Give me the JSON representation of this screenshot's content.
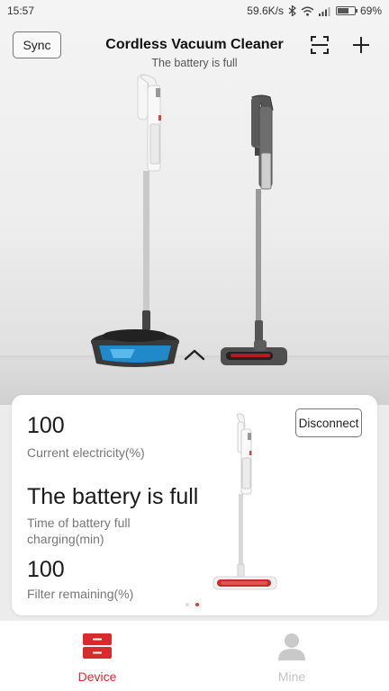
{
  "status_bar": {
    "time": "15:57",
    "network_speed": "59.6K/s",
    "battery_percent": "69%",
    "battery_level": 0.69,
    "icons": [
      "bluetooth-icon",
      "wifi-icon",
      "signal-icon",
      "battery-icon"
    ]
  },
  "header": {
    "sync_label": "Sync",
    "title": "Cordless Vacuum Cleaner",
    "subtitle": "The battery is full",
    "icons": [
      "scan-icon",
      "plus-icon"
    ]
  },
  "card": {
    "electricity_value": "100",
    "electricity_label": "Current electricity(%)",
    "battery_status": "The battery is full",
    "charge_time_label": "Time of battery full charging(min)",
    "filter_value": "100",
    "filter_label": "Filter remaining(%)",
    "disconnect_label": "Disconnect",
    "page_count": 2,
    "active_page": 2
  },
  "nav": {
    "device_label": "Device",
    "mine_label": "Mine"
  },
  "colors": {
    "accent": "#d92b2b",
    "inactive": "#c4c4c4"
  }
}
